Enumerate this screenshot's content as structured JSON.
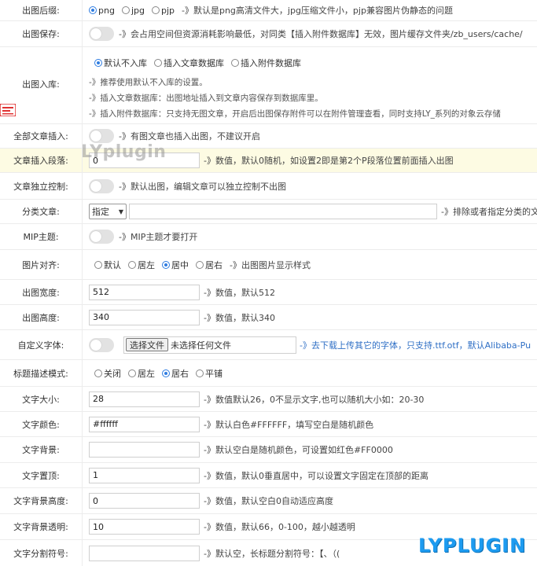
{
  "rows": {
    "format": {
      "label": "出图后缀:",
      "options": [
        "png",
        "jpg",
        "pjp"
      ],
      "selected": "png",
      "desc": "-》默认是png高清文件大，jpg压缩文件小，pjp兼容图片伪静态的问题"
    },
    "save": {
      "label": "出图保存:",
      "desc": "-》会占用空间但资源消耗影响最低，对同类【插入附件数据库】无效，图片缓存文件夹/zb_users/cache/"
    },
    "storage": {
      "label": "出图入库:",
      "options": [
        "默认不入库",
        "插入文章数据库",
        "插入附件数据库"
      ],
      "selected": "默认不入库",
      "notes": [
        "-》推荐使用默认不入库的设置。",
        "-》插入文章数据库：出图地址插入到文章内容保存到数据库里。",
        "-》插入附件数据库：只支持无图文章，开启后出图保存附件可以在附件管理查看，同时支持LY_系列的对象云存储"
      ]
    },
    "all_insert": {
      "label": "全部文章插入:",
      "desc": "-》有图文章也插入出图，不建议开启"
    },
    "paragraph": {
      "label": "文章插入段落:",
      "value": "0",
      "desc": "-》数值，默认0随机，如设置2即是第2个P段落位置前面插入出图"
    },
    "independent": {
      "label": "文章独立控制:",
      "desc": "-》默认出图，编辑文章可以独立控制不出图"
    },
    "category": {
      "label": "分类文章:",
      "select_value": "指定",
      "input_value": "",
      "desc": "-》排除或者指定分类的文"
    },
    "mip": {
      "label": "MIP主题:",
      "desc": "-》MIP主题才要打开"
    },
    "align": {
      "label": "图片对齐:",
      "options": [
        "默认",
        "居左",
        "居中",
        "居右"
      ],
      "selected": "居中",
      "desc": "-》出图图片显示样式"
    },
    "width": {
      "label": "出图宽度:",
      "value": "512",
      "desc": "-》数值，默认512"
    },
    "height": {
      "label": "出图高度:",
      "value": "340",
      "desc": "-》数值，默认340"
    },
    "font": {
      "label": "自定义字体:",
      "button": "选择文件",
      "file_status": "未选择任何文件",
      "desc": "-》去下载上传其它的字体，只支持.ttf.otf，默认Alibaba-Pu"
    },
    "title_mode": {
      "label": "标题描述模式:",
      "options": [
        "关闭",
        "居左",
        "居右",
        "平铺"
      ],
      "selected": "居右"
    },
    "text_size": {
      "label": "文字大小:",
      "value": "28",
      "desc": "-》数值默认26，0不显示文字,也可以随机大小如：20-30"
    },
    "text_color": {
      "label": "文字颜色:",
      "value": "#ffffff",
      "desc": "-》默认白色#FFFFFF，填写空白是随机颜色"
    },
    "text_bg": {
      "label": "文字背景:",
      "value": "",
      "desc": "-》默认空白是随机颜色，可设置如红色#FF0000"
    },
    "text_top": {
      "label": "文字置顶:",
      "value": "1",
      "desc": "-》数值，默认0垂直居中，可以设置文字固定在顶部的距离"
    },
    "bg_height": {
      "label": "文字背景高度:",
      "value": "0",
      "desc": "-》数值，默认空白0自动适应高度"
    },
    "bg_opacity": {
      "label": "文字背景透明:",
      "value": "10",
      "desc": "-》数值，默认66，0-100，越小越透明"
    },
    "separator": {
      "label": "文字分割符号:",
      "value": "",
      "desc": "-》默认空，长标题分割符号：【、（("
    }
  },
  "watermarks": {
    "center": "LYplugin",
    "corner": "LYPLUGIN"
  },
  "colors": {
    "accent": "#2f7de1",
    "toggle_off": "#e2e2e2",
    "highlight_row": "#fdfbe3",
    "link_blue": "#2f6fc5",
    "logo_red": "#e03131",
    "corner_watermark": "#1d9bf0"
  }
}
